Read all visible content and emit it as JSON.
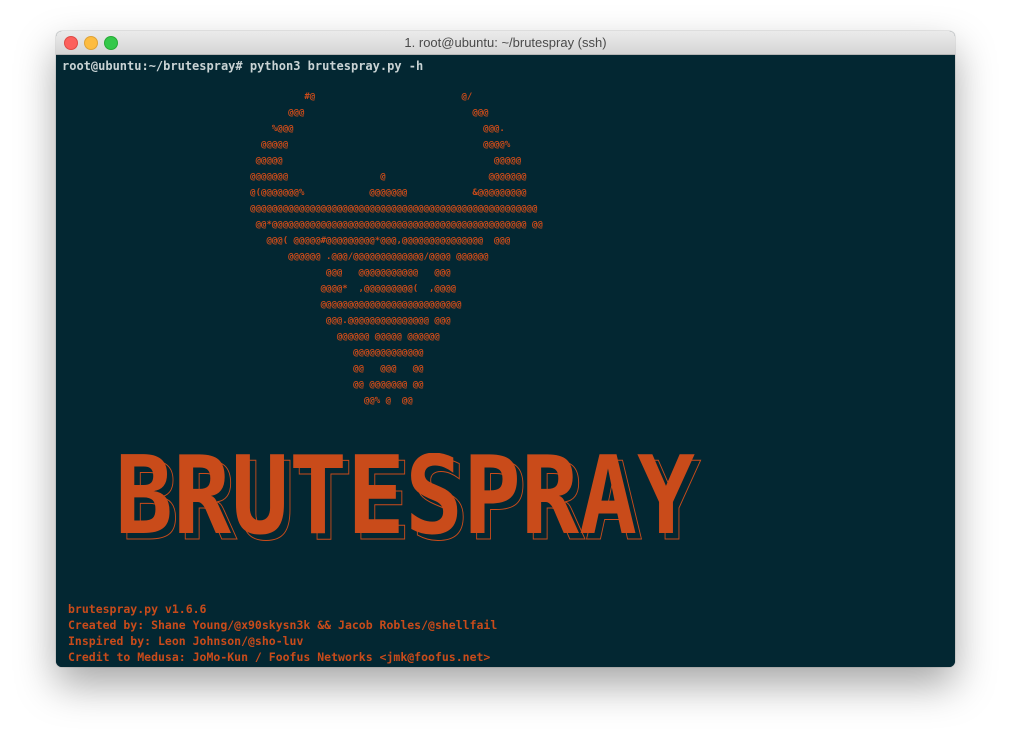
{
  "window": {
    "title": "1. root@ubuntu: ~/brutespray (ssh)",
    "colors": {
      "background": "#032732",
      "accent": "#c94b1a",
      "prompt": "#c9d3d4"
    }
  },
  "terminal": {
    "prompt_line": "root@ubuntu:~/brutespray# python3 brutespray.py -h",
    "ascii_art": "                    #@                           @/\n                 @@@                               @@@\n              %@@@                                   @@@.\n            @@@@@                                    @@@@%\n           @@@@@                                       @@@@@\n          @@@@@@@                 @                   @@@@@@@\n          @(@@@@@@@%            @@@@@@@            &@@@@@@@@@\n          @@@@@@@@@@@@@@@@@@@@@@@@@@@@@@@@@@@@@@@@@@@@@@@@@@@@@\n           @@*@@@@@@@@@@@@@@@@@@@@@@@@@@@@@@@@@@@@@@@@@@@@@@@ @@\n             @@@( @@@@@#@@@@@@@@@*@@@,@@@@@@@@@@@@@@@  @@@\n                 @@@@@@ .@@@/@@@@@@@@@@@@@/@@@@ @@@@@@\n                        @@@   @@@@@@@@@@@   @@@\n                       @@@@*  ,@@@@@@@@@(  ,@@@@\n                       @@@@@@@@@@@@@@@@@@@@@@@@@@\n                        @@@.@@@@@@@@@@@@@@@ @@@\n                          @@@@@@ @@@@@ @@@@@@\n                             @@@@@@@@@@@@@\n                             @@   @@@   @@\n                             @@ @@@@@@@ @@\n                               @@% @  @@",
    "banner_text": "BRUTESPRAY",
    "credits": [
      "brutespray.py v1.6.6",
      "Created by: Shane Young/@x90skysn3k && Jacob Robles/@shellfail",
      "Inspired by: Leon Johnson/@sho-luv",
      "Credit to Medusa: JoMo-Kun / Foofus Networks <jmk@foofus.net>"
    ]
  }
}
